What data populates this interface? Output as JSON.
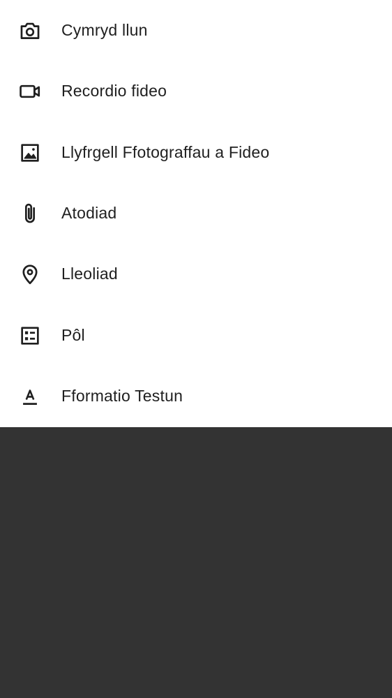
{
  "menu": {
    "items": [
      {
        "label": "Cymryd llun",
        "icon": "camera-icon"
      },
      {
        "label": "Recordio fideo",
        "icon": "video-camera-icon"
      },
      {
        "label": "Llyfrgell Ffotograffau a Fideo",
        "icon": "image-icon"
      },
      {
        "label": "Atodiad",
        "icon": "paperclip-icon"
      },
      {
        "label": "Lleoliad",
        "icon": "location-pin-icon"
      },
      {
        "label": "Pôl",
        "icon": "poll-icon"
      },
      {
        "label": "Fformatio Testun",
        "icon": "text-format-icon"
      }
    ]
  },
  "colors": {
    "sheet_background": "#ffffff",
    "scrim": "#333333",
    "text": "#1f1f1f",
    "icon": "#1f1f1f"
  }
}
